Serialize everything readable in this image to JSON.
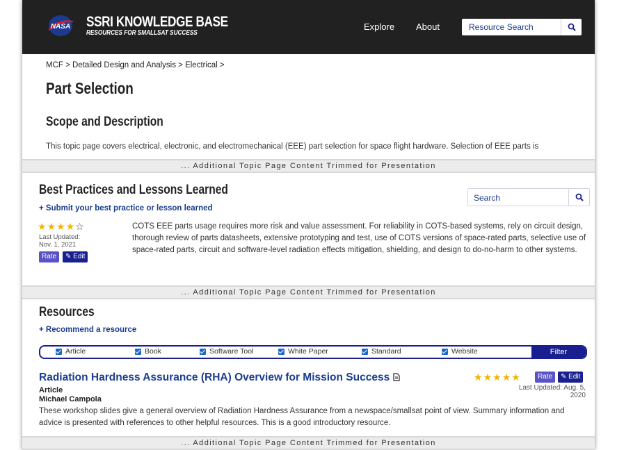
{
  "header": {
    "logo_text": "NASA",
    "brand_title": "SSRI KNOWLEDGE BASE",
    "brand_subtitle": "RESOURCES FOR SMALLSAT SUCCESS",
    "nav": [
      "Explore",
      "About"
    ],
    "search_label": "Resource Search",
    "search_icon": "search-icon"
  },
  "breadcrumb": "MCF > Detailed Design and Analysis > Electrical >",
  "page_title": "Part Selection",
  "scope": {
    "title": "Scope and Description",
    "text": "This topic page covers electrical, electronic, and electromechanical (EEE) part selection for space flight hardware. Selection of EEE parts is"
  },
  "trim_notice": "... Additional Topic Page Content Trimmed for Presentation",
  "best_practices": {
    "title": "Best Practices and Lessons Learned",
    "submit_link": "+ Submit your best practice or lesson learned",
    "search_label": "Search",
    "rating": 4,
    "rating_max": 5,
    "updated_label": "Last Updated:",
    "updated_date": "Nov. 1, 2021",
    "rate_label": "Rate",
    "edit_label": "✎ Edit",
    "text": "COTS EEE parts usage requires more risk and value assessment. For reliability in COTS-based systems, rely on circuit design, thorough review of parts datasheets, extensive prototyping and test, use of COTS versions of space-rated parts, selective use of space-rated parts, circuit and software-level radiation effects mitigation, shielding, and design to do-no-harm to other systems."
  },
  "resources": {
    "title": "Resources",
    "recommend_link": "+ Recommend a resource",
    "filters": [
      "Article",
      "Book",
      "Software Tool",
      "White Paper",
      "Standard",
      "Website"
    ],
    "filter_button": "Filter",
    "item": {
      "title": "Radiation Hardness Assurance (RHA) Overview for Mission Success",
      "type": "Article",
      "author": "Michael Campola",
      "rating": 5,
      "rate_label": "Rate",
      "edit_label": "✎ Edit",
      "updated": "Last Updated: Aug. 5, 2020",
      "text": "These workshop slides give a general overview of Radiation Hardness Assurance from a newspace/smallsat point of view. Summary information and advice is presented with references to other helpful resources. This is a good introductory resource."
    }
  },
  "colors": {
    "header_bg": "#212121",
    "link_blue": "#1a3d8f",
    "star_gold": "#f0b400",
    "button_navy": "#1a1f8f",
    "button_purple": "#5a52c8"
  }
}
